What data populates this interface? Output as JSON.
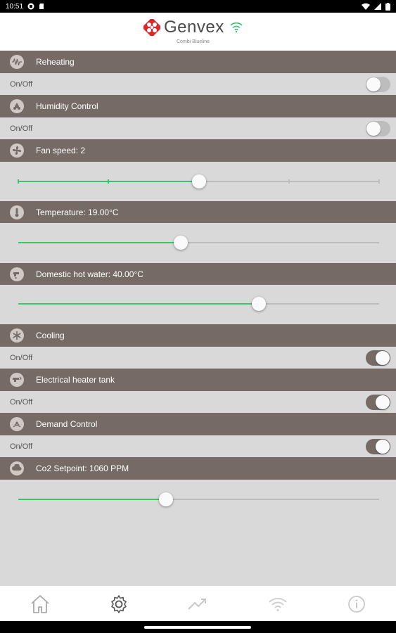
{
  "status_bar": {
    "time": "10:51"
  },
  "brand": {
    "name": "Genvex",
    "subtitle": "Combi Blueline"
  },
  "sections": {
    "reheating": {
      "title": "Reheating",
      "onoff_label": "On/Off",
      "enabled": false,
      "icon": "heating-coil-icon"
    },
    "humidity": {
      "title": "Humidity Control",
      "onoff_label": "On/Off",
      "enabled": false,
      "icon": "droplets-icon"
    },
    "fan_speed": {
      "title": "Fan speed: 2",
      "value": 2,
      "min": 0,
      "max": 4,
      "icon": "fan-icon"
    },
    "temperature": {
      "title": "Temperature: 19.00°C",
      "fraction": 0.45,
      "icon": "thermometer-icon"
    },
    "hot_water": {
      "title": "Domestic hot water: 40.00°C",
      "fraction": 0.667,
      "icon": "faucet-icon"
    },
    "cooling": {
      "title": "Cooling",
      "onoff_label": "On/Off",
      "enabled": true,
      "icon": "snowflake-icon"
    },
    "heater_tank": {
      "title": "Electrical heater tank",
      "onoff_label": "On/Off",
      "enabled": true,
      "icon": "tank-icon"
    },
    "demand": {
      "title": "Demand Control",
      "onoff_label": "On/Off",
      "enabled": true,
      "icon": "sensor-icon"
    },
    "co2": {
      "title": "Co2 Setpoint: 1060 PPM",
      "fraction": 0.41,
      "icon": "co2-icon"
    }
  },
  "bottom_nav": [
    "home-icon",
    "settings-icon",
    "trend-icon",
    "wifi-icon",
    "info-icon"
  ],
  "colors": {
    "header_bg": "#756a65",
    "accent_green": "#3cc46a",
    "toggle_on": "#756a65",
    "background": "#d9d9d9"
  }
}
